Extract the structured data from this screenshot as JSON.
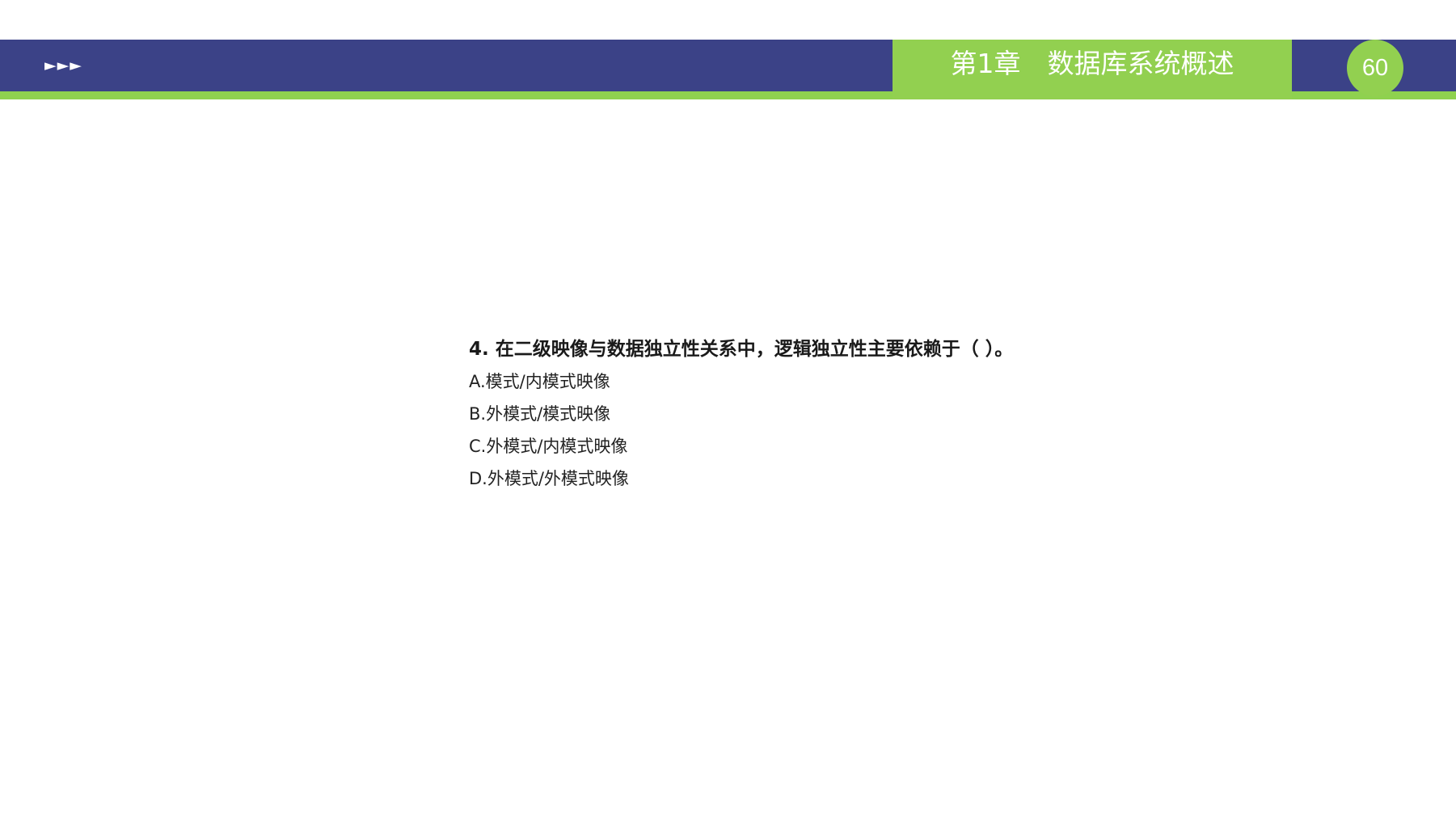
{
  "header": {
    "nav_arrows": "►►►",
    "chapter_title": "第1章　数据库系统概述",
    "page_number": "60"
  },
  "question": {
    "title": "4. 在二级映像与数据独立性关系中，逻辑独立性主要依赖于（ ）。",
    "options": [
      "A.模式/内模式映像",
      "B.外模式/模式映像",
      "C.外模式/内模式映像",
      "D.外模式/外模式映像"
    ]
  },
  "colors": {
    "header_blue": "#3b4287",
    "accent_green": "#92d050",
    "underline_green": "#8fd14f",
    "text": "#1a1a1a",
    "background": "#ffffff"
  }
}
